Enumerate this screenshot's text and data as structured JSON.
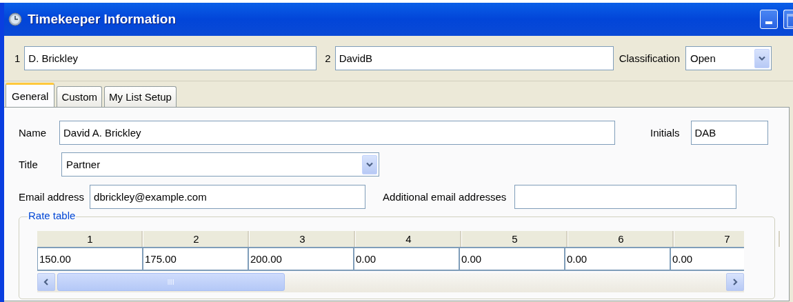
{
  "window": {
    "title": "Timekeeper Information"
  },
  "header": {
    "field_1": {
      "label": "1",
      "value": "D. Brickley"
    },
    "field_2": {
      "label": "2",
      "value": "DavidB"
    },
    "classification": {
      "label": "Classification",
      "value": "Open"
    }
  },
  "tabs": [
    {
      "label": "General",
      "selected": true
    },
    {
      "label": "Custom",
      "selected": false
    },
    {
      "label": "My List Setup",
      "selected": false
    }
  ],
  "general": {
    "name": {
      "label": "Name",
      "value": "David A. Brickley"
    },
    "initials": {
      "label": "Initials",
      "value": "DAB"
    },
    "title": {
      "label": "Title",
      "value": "Partner"
    },
    "email": {
      "label": "Email address",
      "value": "dbrickley@example.com"
    },
    "additional_email": {
      "label": "Additional email addresses"
    }
  },
  "rate_table": {
    "title": "Rate table",
    "columns": [
      "1",
      "2",
      "3",
      "4",
      "5",
      "6",
      "7"
    ],
    "rows": [
      [
        "150.00",
        "175.00",
        "200.00",
        "0.00",
        "0.00",
        "0.00",
        "0.00"
      ]
    ]
  }
}
